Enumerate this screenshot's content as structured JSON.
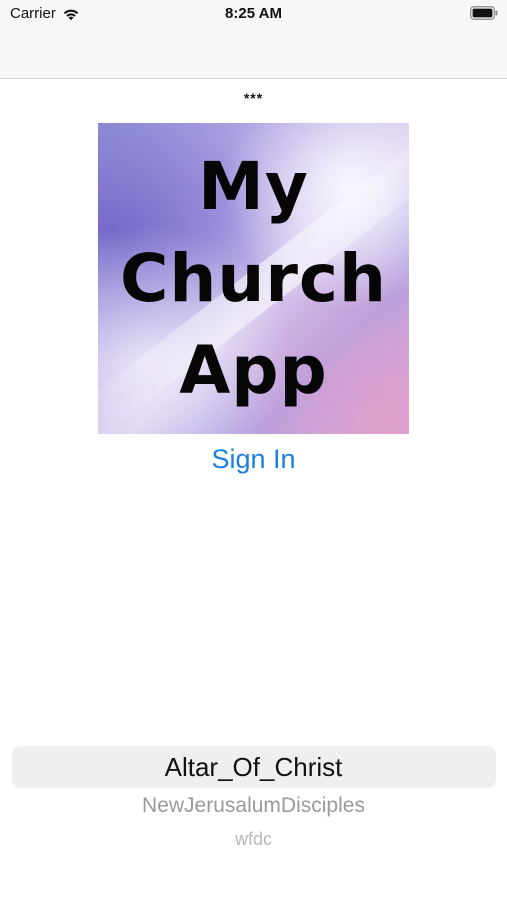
{
  "status_bar": {
    "carrier": "Carrier",
    "time": "8:25 AM",
    "icons": [
      "wifi-icon",
      "battery-icon"
    ]
  },
  "header": {
    "stars": "***"
  },
  "logo": {
    "lines": [
      "My",
      "Church",
      "App"
    ]
  },
  "actions": {
    "sign_in": "Sign In"
  },
  "picker": {
    "selected": "Altar_Of_Christ",
    "options": [
      "NewJerusalumDisciples",
      "wfdc"
    ]
  },
  "colors": {
    "accent": "#1a7fe0",
    "bar_background": "#f7f7f7"
  }
}
